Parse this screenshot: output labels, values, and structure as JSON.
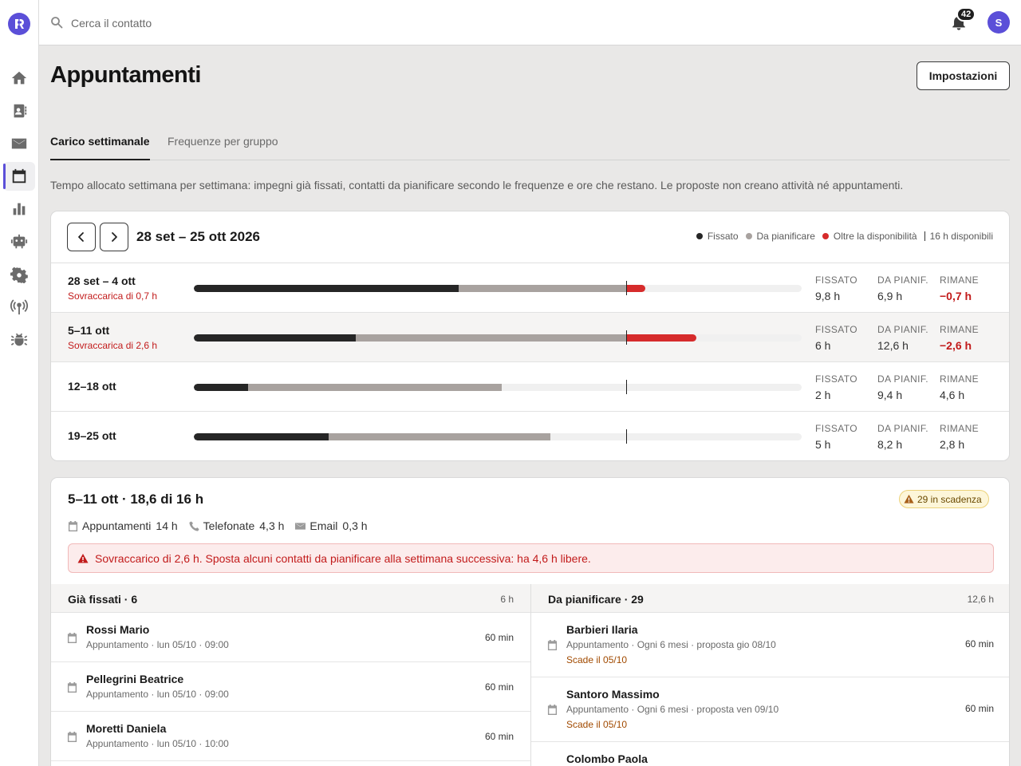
{
  "search": {
    "placeholder": "Cerca il contatto"
  },
  "notifications": {
    "count": "42"
  },
  "user": {
    "initial": "S"
  },
  "page": {
    "title": "Appuntamenti",
    "settings_label": "Impostazioni",
    "description": "Tempo allocato settimana per settimana: impegni già fissati, contatti da pianificare secondo le frequenze e ore che restano. Le proposte non creano attività né appuntamenti."
  },
  "tabs": [
    {
      "label": "Carico settimanale",
      "active": true
    },
    {
      "label": "Frequenze per gruppo",
      "active": false
    }
  ],
  "weeks_card": {
    "range": "28 set – 25 ott 2026",
    "legend": {
      "fixed": "Fissato",
      "plan": "Da pianificare",
      "over": "Oltre la disponibilità",
      "capacity": "16 h disponibili"
    },
    "capacity_hours": 16,
    "scale_max_hours": 22.5,
    "stat_labels": {
      "fixed": "FISSATO",
      "plan": "DA PIANIF.",
      "remaining": "RIMANE"
    },
    "weeks": [
      {
        "label": "28 set – 4 ott",
        "warning": "Sovraccarica di 0,7 h",
        "fixed_hours": 9.8,
        "plan_hours": 6.9,
        "fixed": "9,8 h",
        "plan": "6,9 h",
        "remaining": "−0,7 h",
        "negative": true
      },
      {
        "label": "5–11 ott",
        "warning": "Sovraccarica di 2,6 h",
        "fixed_hours": 6,
        "plan_hours": 12.6,
        "fixed": "6 h",
        "plan": "12,6 h",
        "remaining": "−2,6 h",
        "negative": true,
        "selected": true
      },
      {
        "label": "12–18 ott",
        "warning": "",
        "fixed_hours": 2,
        "plan_hours": 9.4,
        "fixed": "2 h",
        "plan": "9,4 h",
        "remaining": "4,6 h",
        "negative": false
      },
      {
        "label": "19–25 ott",
        "warning": "",
        "fixed_hours": 5,
        "plan_hours": 8.2,
        "fixed": "5 h",
        "plan": "8,2 h",
        "remaining": "2,8 h",
        "negative": false
      }
    ]
  },
  "detail": {
    "title": "5–11 ott · 18,6 di 16 h",
    "due_badge": "29 in scadenza",
    "breakdown": [
      {
        "icon": "calendar-icon",
        "label": "Appuntamenti",
        "value": "14 h"
      },
      {
        "icon": "phone-icon",
        "label": "Telefonate",
        "value": "4,3 h"
      },
      {
        "icon": "mail-icon",
        "label": "Email",
        "value": "0,3 h"
      }
    ],
    "alert": "Sovraccarico di 2,6 h. Sposta alcuni contatti da pianificare alla settimana successiva: ha 4,6 h libere.",
    "fixed_column": {
      "title": "Già fissati · 6",
      "total": "6 h",
      "items": [
        {
          "name": "Rossi Mario",
          "sub": "Appuntamento · lun 05/10 · 09:00",
          "duration": "60 min"
        },
        {
          "name": "Pellegrini Beatrice",
          "sub": "Appuntamento · lun 05/10 · 09:00",
          "duration": "60 min"
        },
        {
          "name": "Moretti Daniela",
          "sub": "Appuntamento · lun 05/10 · 10:00",
          "duration": "60 min"
        }
      ]
    },
    "plan_column": {
      "title": "Da pianificare · 29",
      "total": "12,6 h",
      "items": [
        {
          "name": "Barbieri Ilaria",
          "sub": "Appuntamento · Ogni 6 mesi · proposta gio 08/10",
          "due": "Scade il 05/10",
          "duration": "60 min"
        },
        {
          "name": "Santoro Massimo",
          "sub": "Appuntamento · Ogni 6 mesi · proposta ven 09/10",
          "due": "Scade il 05/10",
          "duration": "60 min"
        },
        {
          "name": "Colombo Paola",
          "sub": "",
          "due": "",
          "duration": ""
        }
      ]
    }
  },
  "colors": {
    "accent": "#5b4fd8",
    "fixed": "#262626",
    "plan": "#a8a29f",
    "over": "#d62b2b"
  }
}
